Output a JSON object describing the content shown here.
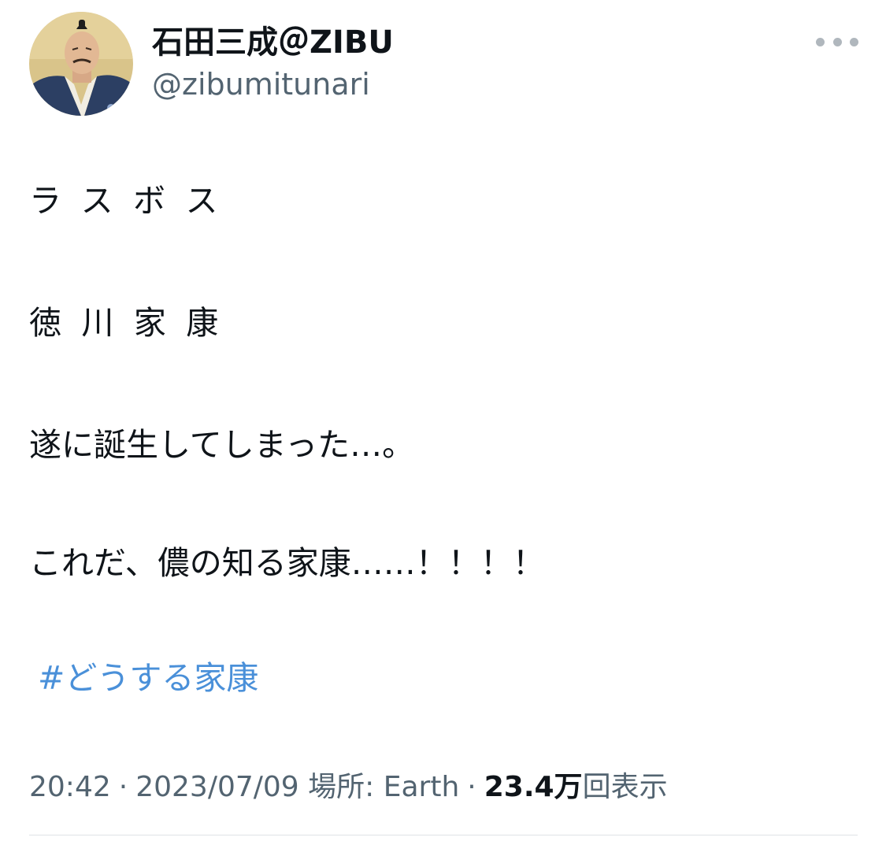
{
  "author": {
    "display_name": "石田三成＠ZIBU",
    "handle": "@zibumitunari",
    "avatar_icon": "samurai-portrait-avatar"
  },
  "more_icon": "more-horizontal-icon",
  "tweet": {
    "lines": [
      "ラスボス",
      "徳川家康",
      "遂に誕生してしまった…。",
      "これだ、儂の知る家康……！！！！"
    ],
    "hashtag": "#どうする家康"
  },
  "meta": {
    "time": "20:42",
    "date": "2023/07/09",
    "location_label": "場所: Earth",
    "views_count": "23.4万",
    "views_label": "回表示"
  },
  "colors": {
    "link": "#4a90d9",
    "secondary_text": "#536471",
    "primary_text": "#0f1419"
  }
}
